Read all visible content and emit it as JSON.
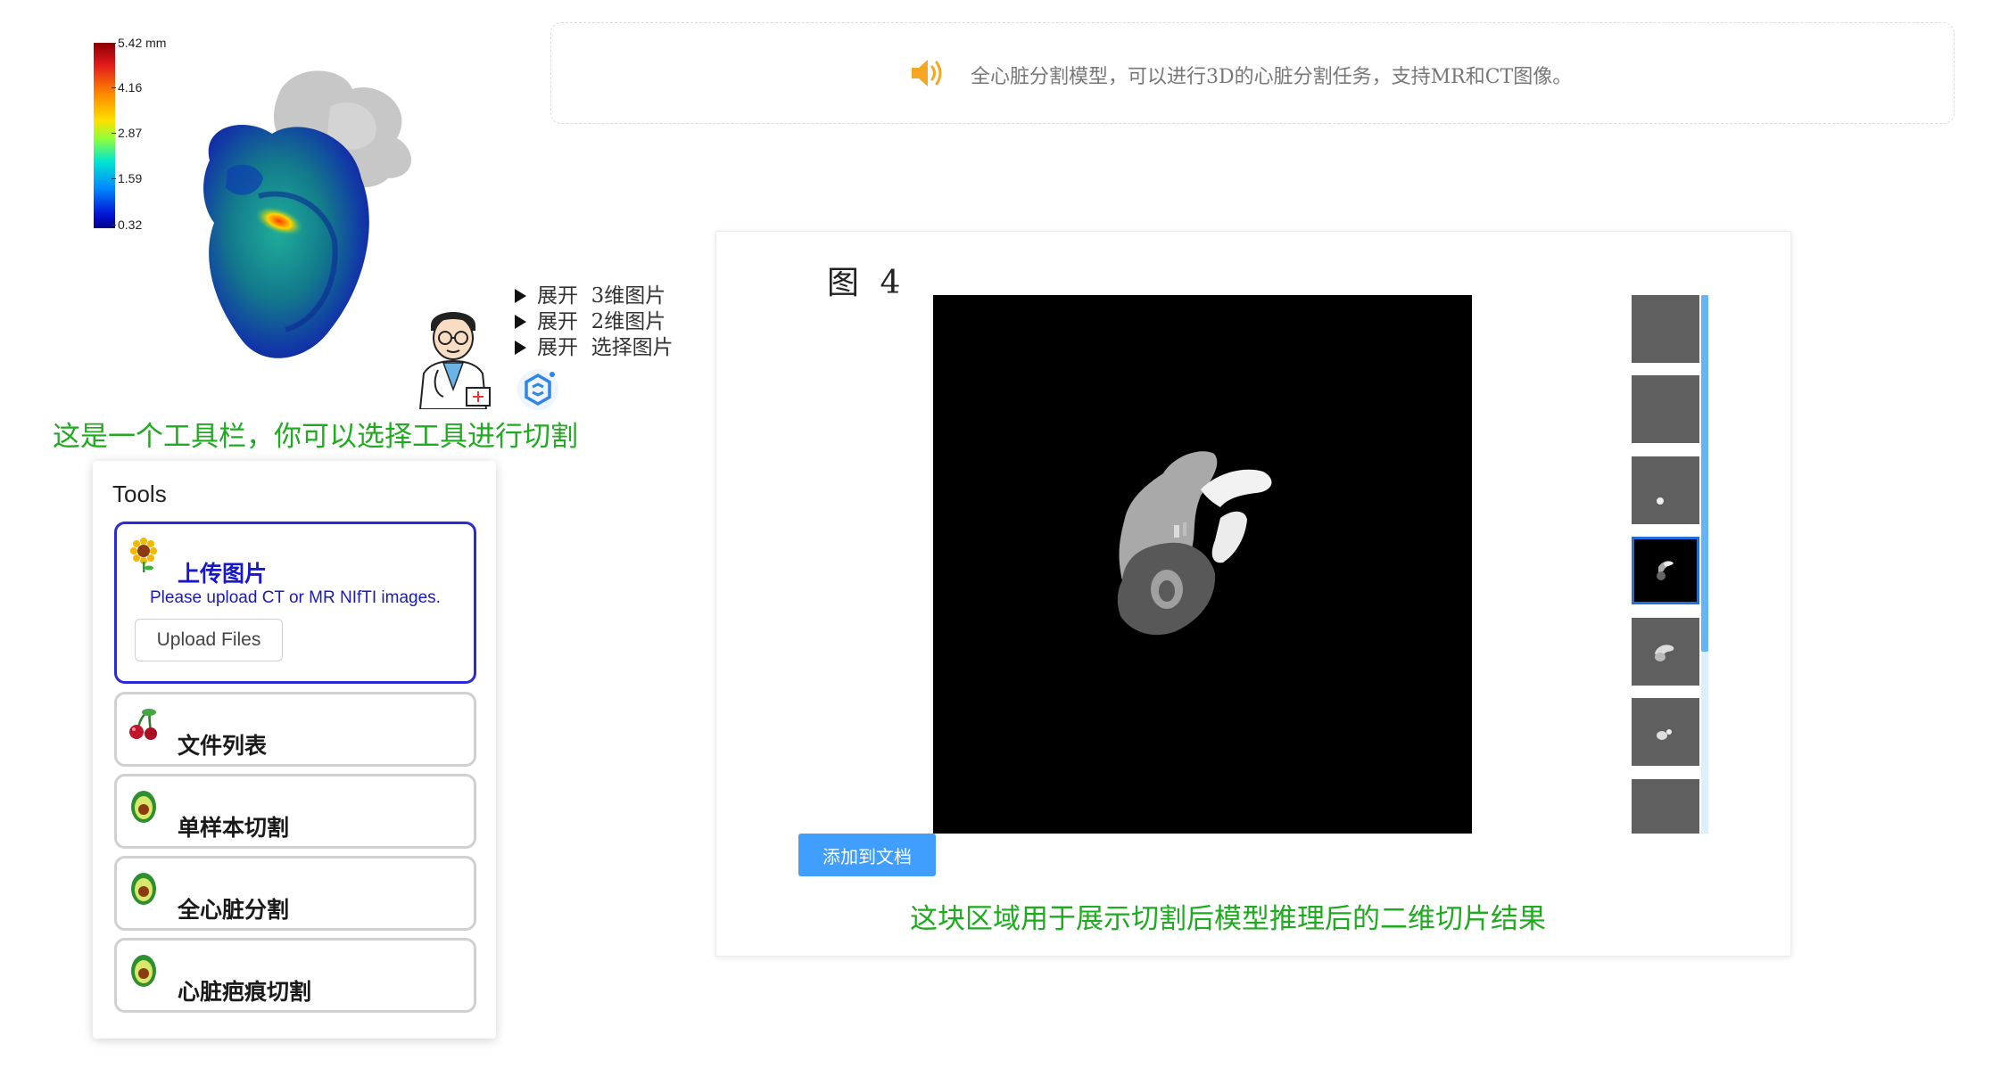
{
  "colorbar": {
    "labels": [
      "5.42 mm",
      "4.16",
      "2.87",
      "1.59",
      "0.32"
    ]
  },
  "expand": {
    "marker": "展开",
    "items": [
      "3维图片",
      "2维图片",
      "选择图片"
    ]
  },
  "captions": {
    "toolbar": "这是一个工具栏，你可以选择工具进行切割",
    "result": "这块区域用于展示切割后模型推理后的二维切片结果"
  },
  "tools": {
    "title": "Tools",
    "upload": {
      "title": "上传图片",
      "description": "Please upload CT or MR NIfTI images.",
      "button": "Upload Files"
    },
    "items": [
      {
        "title": "文件列表",
        "icon": "cherry-icon"
      },
      {
        "title": "单样本切割",
        "icon": "avocado-icon"
      },
      {
        "title": "全心脏分割",
        "icon": "avocado-icon"
      },
      {
        "title": "心脏疤痕切割",
        "icon": "avocado-icon"
      }
    ],
    "upload_icon": "sunflower-icon"
  },
  "notice": {
    "icon": "speaker-icon",
    "text": "全心脏分割模型，可以进行3D的心脏分割任务，支持MR和CT图像。"
  },
  "result": {
    "figure_label": "图 4",
    "add_button": "添加到文档",
    "thumbnails_count": 7,
    "selected_thumbnail": 4
  },
  "colors": {
    "caption_green": "#1faa1f",
    "active_border": "#2a2ad8",
    "button_blue": "#409eff",
    "notice_icon": "#f5a623"
  }
}
